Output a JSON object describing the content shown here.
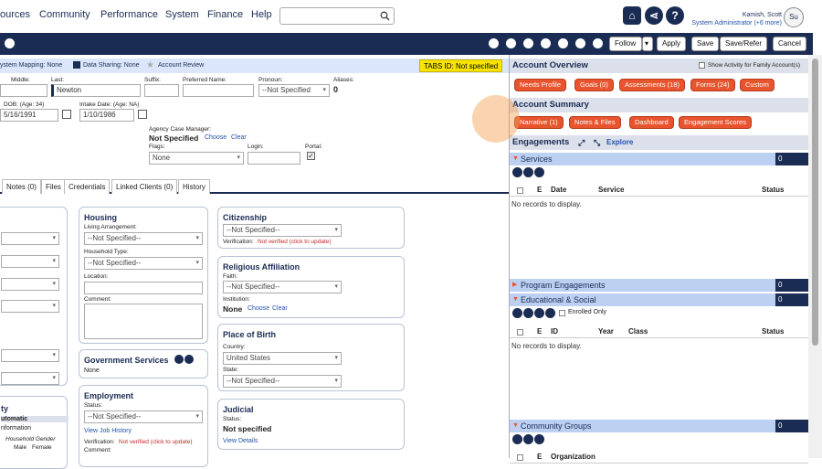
{
  "nav": {
    "items": [
      "ources",
      "Community",
      "Performance",
      "System",
      "Finance",
      "Help"
    ]
  },
  "search": {
    "placeholder": ""
  },
  "user": {
    "name": "Kamish, Scott",
    "role": "System Administrator (+6 more)",
    "avatar": "Su"
  },
  "toolbar": {
    "follow": "Follow",
    "apply": "Apply",
    "save": "Save",
    "save_refer": "Save/Refer",
    "cancel": "Cancel"
  },
  "infostrip": {
    "system_mapping": "ystem Mapping: None",
    "data_sharing": "Data Sharing: None",
    "account_review": "Account Review",
    "tabs_id": "TABS ID: Not specified"
  },
  "client": {
    "middle_label": "Middle:",
    "last_label": "Last:",
    "last_value": "Newton",
    "suffix_label": "Suffix:",
    "preferred_label": "Preferred Name:",
    "pronoun_label": "Pronoun:",
    "pronoun_value": "--Not Specified",
    "aliases_label": "Aliases:",
    "aliases_value": "0",
    "dob_label": "DOB: (Age: 34)",
    "dob_value": "5/16/1991",
    "intake_label": "Intake Date: (Age: NA)",
    "intake_value": "1/10/1986",
    "acm_label": "Agency Case Manager:",
    "acm_value": "Not Specified",
    "choose": "Choose",
    "clear": "Clear",
    "flags_label": "Flags:",
    "flags_value": "None",
    "login_label": "Login:",
    "portal_label": "Portal:"
  },
  "tabs": [
    "Notes (0)",
    "Files",
    "Credentials",
    "Linked Clients (0)",
    "History"
  ],
  "housing": {
    "title": "Housing",
    "living_label": "Living Arrangement:",
    "living_value": "--Not Specified--",
    "hh_type_label": "Household Type:",
    "hh_type_value": "--Not Specified--",
    "location_label": "Location:",
    "comment_label": "Comment:"
  },
  "gov": {
    "title": "Government Services",
    "value": "None"
  },
  "employment": {
    "title": "Employment",
    "status_label": "Status:",
    "status_value": "--Not Specified--",
    "view_history": "View Job History",
    "verification_label": "Verification:",
    "verification_value": "Not verified (click to update)",
    "comment_label": "Comment:"
  },
  "citizenship": {
    "title": "Citizenship",
    "value": "--Not Specified--",
    "verification_label": "Verification:",
    "verification_value": "Not verified (click to update)"
  },
  "religion": {
    "title": "Religious Affiliation",
    "faith_label": "Faith:",
    "faith_value": "--Not Specified--",
    "institution_label": "Institution:",
    "institution_value": "None",
    "choose": "Choose",
    "clear": "Clear"
  },
  "birth": {
    "title": "Place of Birth",
    "country_label": "Country:",
    "country_value": "United States",
    "state_label": "State:",
    "state_value": "--Not Specified--"
  },
  "judicial": {
    "title": "Judicial",
    "status_label": "Status:",
    "status_value": "Not specified",
    "view": "View Details"
  },
  "left_card": {
    "title": "ty",
    "automatic": "utomatic",
    "information": "nformation",
    "hh_gender": "Household Gender",
    "male": "Male",
    "female": "Female"
  },
  "overview": {
    "title": "Account Overview",
    "show_activity": "Show Activity for Family Account(s)",
    "pills": [
      "Needs Profile",
      "Goals (0)",
      "Assessments (18)",
      "Forms (24)",
      "Custom"
    ]
  },
  "summary": {
    "title": "Account Summary",
    "pills": [
      "Narrative (1)",
      "Notes & Files",
      "Dashboard",
      "Engagement Scores"
    ]
  },
  "engagements": {
    "title": "Engagements",
    "explore": "Explore"
  },
  "services": {
    "title": "Services",
    "count": "0",
    "cols": [
      "E",
      "Date",
      "Service",
      "Status"
    ],
    "empty": "No records to display."
  },
  "program": {
    "title": "Program Engagements",
    "count": "0"
  },
  "educational": {
    "title": "Educational & Social",
    "count": "0",
    "enrolled_only": "Enrolled Only",
    "cols": [
      "E",
      "ID",
      "Year",
      "Class",
      "Status"
    ],
    "empty": "No records to display."
  },
  "community": {
    "title": "Community Groups",
    "count": "0",
    "cols": [
      "E",
      "Organization"
    ]
  }
}
